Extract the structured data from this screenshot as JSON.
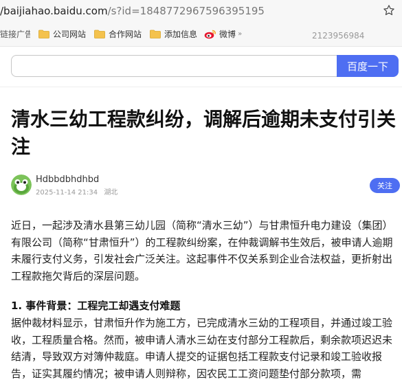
{
  "browser": {
    "url_host": "/baijiahao.baidu.com",
    "url_rest": "/s?id=1848772967596395195"
  },
  "bookmarks": {
    "items": [
      "链接广告",
      "公司网站",
      "合作网站",
      "添加信息",
      "微博"
    ],
    "number": "2123956984"
  },
  "search": {
    "placeholder": "",
    "button_label": "百度一下"
  },
  "article": {
    "title": "清水三幼工程款纠纷，调解后逾期未支付引关注",
    "author": "Hdbbdbhdhbd",
    "date": "2025-11-14 21:34",
    "location": "湖北",
    "follow_label": "关注",
    "paragraphs": [
      "近日，一起涉及清水县第三幼儿园（简称“清水三幼”）与甘肃恒升电力建设（集团）有限公司（简称“甘肃恒升”）的工程款纠纷案，在仲裁调解书生效后，被申请人逾期未履行支付义务，引发社会广泛关注。这起事件不仅关系到企业合法权益，更折射出工程款拖欠背后的深层问题。"
    ],
    "section_heading": "1. 事件背景：工程完工却遇支付难题",
    "section_paragraph": "据仲裁材料显示，甘肃恒升作为施工方，已完成清水三幼的工程项目，并通过竣工验收，工程质量合格。然而，被申请人清水三幼在支付部分工程款后，剩余款项迟迟未结清，导致双方对簿仲裁庭。申请人提交的证据包括工程款支付记录和竣工验收报告，证实其履约情况；被申请人则辩称，因农民工工资问题垫付部分款项，需"
  },
  "colors": {
    "accent": "#4e6ef2",
    "folder": "#f4c24d"
  }
}
